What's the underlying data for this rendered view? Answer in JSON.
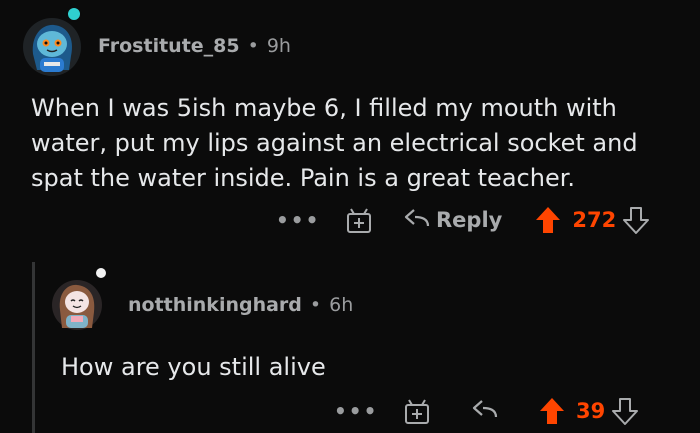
{
  "colors": {
    "upvote": "#ff4500",
    "online": "#2fd0d0",
    "background": "#0b0b0b",
    "text": "#e6e8ea",
    "muted": "#9a9c9e"
  },
  "comments": [
    {
      "username": "Frostitute_85",
      "separator": "•",
      "age": "9h",
      "lines": [
        "When I was 5ish maybe 6, I filled my mouth with",
        "water, put my lips against an electrical socket and",
        "spat the water inside. Pain is a great teacher."
      ],
      "more": "•••",
      "award_icon": "award-icon",
      "reply_label": "Reply",
      "score": "272",
      "upvoted": true
    },
    {
      "username": "notthinkinghard",
      "separator": "•",
      "age": "6h",
      "lines": [
        "How are you still alive"
      ],
      "more": "•••",
      "award_icon": "award-icon",
      "score": "39",
      "upvoted": true
    }
  ]
}
